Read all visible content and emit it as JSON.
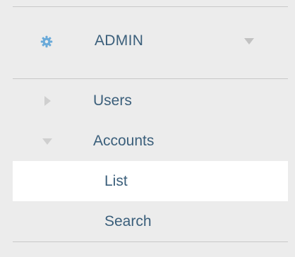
{
  "section": {
    "label": "ADMIN",
    "icon": "gear-icon",
    "toggle_icon": "chevron-down-icon"
  },
  "menu": {
    "items": [
      {
        "label": "Users",
        "icon": "caret-right-icon",
        "expanded": false
      },
      {
        "label": "Accounts",
        "icon": "caret-down-icon",
        "expanded": true,
        "children": [
          {
            "label": "List",
            "active": true
          },
          {
            "label": "Search",
            "active": false
          }
        ]
      }
    ]
  },
  "colors": {
    "background": "#ececec",
    "text": "#3b5f7b",
    "gear_icon": "#6aaad9",
    "active_background": "#ffffff",
    "divider": "#c8c8c8",
    "caret": "#cfcfcf"
  }
}
